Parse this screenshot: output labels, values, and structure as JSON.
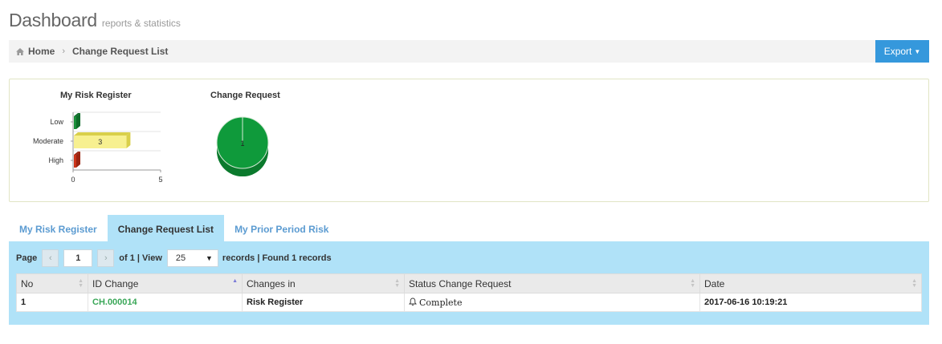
{
  "header": {
    "title": "Dashboard",
    "subtitle": "reports & statistics"
  },
  "breadcrumb": {
    "home": "Home",
    "current": "Change Request List"
  },
  "export_label": "Export",
  "risk_chart": {
    "title": "My Risk Register",
    "chart_data": {
      "type": "bar",
      "orientation": "horizontal",
      "title": "My Risk Register",
      "categories": [
        "Low",
        "Moderate",
        "High"
      ],
      "values": [
        0,
        3,
        0
      ],
      "data_labels": [
        "",
        "3",
        ""
      ],
      "colors": [
        "#1a8f3a",
        "#f7f090",
        "#cc3319"
      ],
      "xlim": [
        0,
        5
      ],
      "x_ticks": [
        "0",
        "5"
      ]
    }
  },
  "change_chart": {
    "title": "Change Request",
    "chart_data": {
      "type": "pie",
      "title": "Change Request",
      "values": [
        1
      ],
      "data_labels": [
        "1"
      ],
      "colors": [
        "#0f9a3b"
      ]
    }
  },
  "tabs": [
    {
      "label": "My Risk Register",
      "active": false
    },
    {
      "label": "Change Request List",
      "active": true
    },
    {
      "label": "My Prior Period Risk",
      "active": false
    }
  ],
  "pager": {
    "page_label": "Page",
    "page_value": "1",
    "of_label": "of 1 | View",
    "view_value": "25",
    "summary": "records | Found 1 records"
  },
  "table": {
    "headers": [
      "No",
      "ID Change",
      "Changes in",
      "Status Change Request",
      "Date"
    ],
    "rows": [
      {
        "no": "1",
        "id": "CH.000014",
        "changes_in": "Risk Register",
        "status": "Complete",
        "date": "2017-06-16 10:19:21"
      }
    ]
  }
}
